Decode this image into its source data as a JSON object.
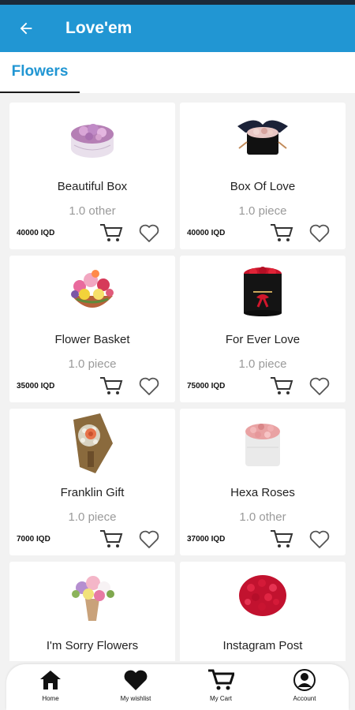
{
  "header": {
    "title": "Love'em"
  },
  "tabs": [
    {
      "label": "Flowers"
    }
  ],
  "products": [
    {
      "name": "Beautiful Box",
      "unit": "1.0 other",
      "price": "40000 IQD"
    },
    {
      "name": "Box Of Love",
      "unit": "1.0 piece",
      "price": "40000 IQD"
    },
    {
      "name": "Flower Basket",
      "unit": "1.0 piece",
      "price": "35000 IQD"
    },
    {
      "name": "For Ever Love",
      "unit": "1.0 piece",
      "price": "75000 IQD"
    },
    {
      "name": "Franklin Gift",
      "unit": "1.0 piece",
      "price": "7000 IQD"
    },
    {
      "name": "Hexa Roses",
      "unit": "1.0 other",
      "price": "37000 IQD"
    },
    {
      "name": "I'm Sorry Flowers"
    },
    {
      "name": "Instagram Post"
    }
  ],
  "bottom_nav": [
    {
      "label": "Home",
      "icon": "home-icon"
    },
    {
      "label": "My wishlist",
      "icon": "heart-icon"
    },
    {
      "label": "My Cart",
      "icon": "cart-icon"
    },
    {
      "label": "Account",
      "icon": "account-icon"
    }
  ],
  "colors": {
    "primary": "#2196d3",
    "heart_outline": "#555555",
    "cart_icon": "#333333"
  }
}
